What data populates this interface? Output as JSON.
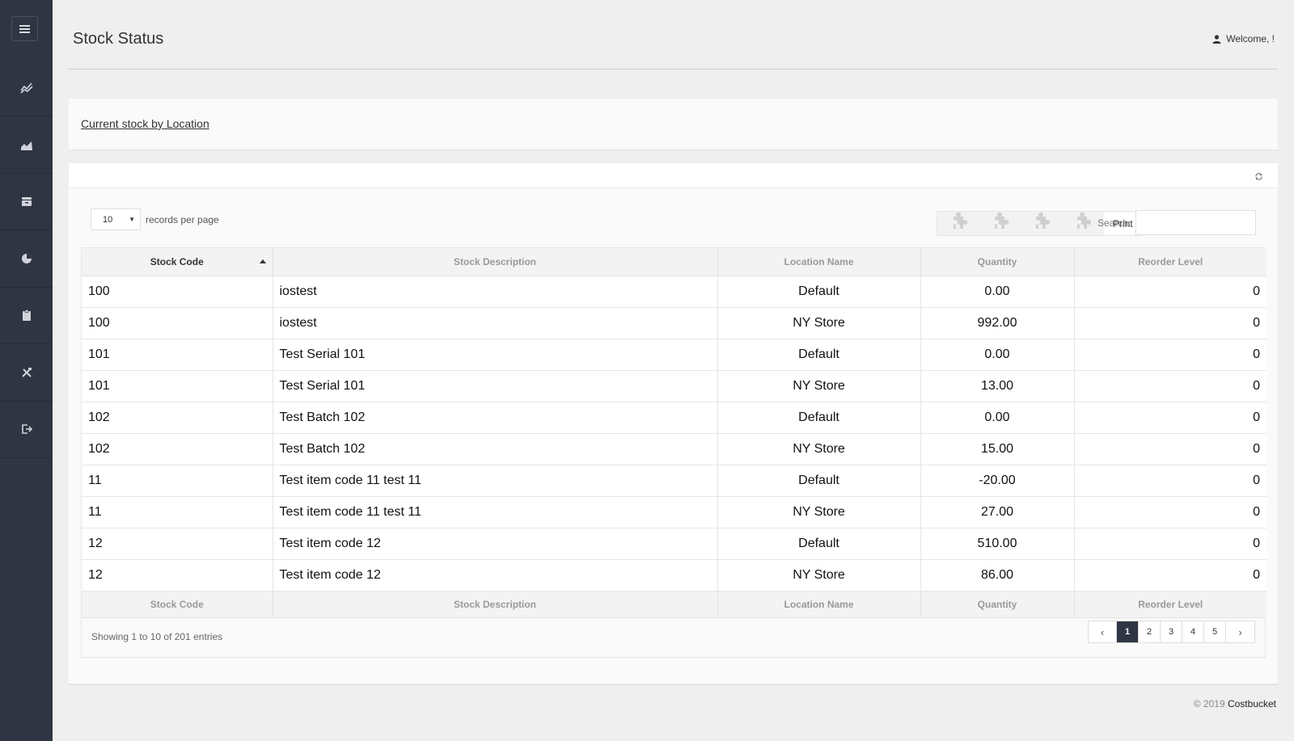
{
  "app": {
    "page_title": "Stock Status",
    "welcome": "Welcome, !",
    "footer_copy": "© 2019",
    "footer_brand": "Costbucket"
  },
  "sidebar": {
    "items": [
      {
        "name": "sidebar-item-trends",
        "icon": "trend-lines-icon"
      },
      {
        "name": "sidebar-item-area-chart",
        "icon": "area-chart-icon"
      },
      {
        "name": "sidebar-item-inventory",
        "icon": "inbox-icon"
      },
      {
        "name": "sidebar-item-reports",
        "icon": "pie-chart-icon"
      },
      {
        "name": "sidebar-item-clipboard",
        "icon": "clipboard-icon"
      },
      {
        "name": "sidebar-item-tools",
        "icon": "tools-icon"
      },
      {
        "name": "sidebar-item-logout",
        "icon": "logout-icon"
      }
    ]
  },
  "panel": {
    "link_label": "Current stock by Location"
  },
  "controls": {
    "records_per_page_value": "10",
    "records_per_page_label": "records per page",
    "print_label": "Print",
    "search_label": "Search:",
    "search_value": ""
  },
  "table": {
    "columns": [
      "Stock Code",
      "Stock Description",
      "Location Name",
      "Quantity",
      "Reorder Level"
    ],
    "rows": [
      [
        "100",
        "iostest",
        "Default",
        "0.00",
        "0"
      ],
      [
        "100",
        "iostest",
        "NY Store",
        "992.00",
        "0"
      ],
      [
        "101",
        "Test Serial 101",
        "Default",
        "0.00",
        "0"
      ],
      [
        "101",
        "Test Serial 101",
        "NY Store",
        "13.00",
        "0"
      ],
      [
        "102",
        "Test Batch 102",
        "Default",
        "0.00",
        "0"
      ],
      [
        "102",
        "Test Batch 102",
        "NY Store",
        "15.00",
        "0"
      ],
      [
        "11",
        "Test item code 11 test 11",
        "Default",
        "-20.00",
        "0"
      ],
      [
        "11",
        "Test item code 11 test 11",
        "NY Store",
        "27.00",
        "0"
      ],
      [
        "12",
        "Test item code 12",
        "Default",
        "510.00",
        "0"
      ],
      [
        "12",
        "Test item code 12",
        "NY Store",
        "86.00",
        "0"
      ]
    ],
    "info": "Showing 1 to 10 of 201 entries"
  },
  "pagination": {
    "prev": "‹",
    "next": "›",
    "pages": [
      "1",
      "2",
      "3",
      "4",
      "5"
    ],
    "active": "1"
  },
  "colors": {
    "sidebar": "#2f3542",
    "active_page": "#2f3542"
  }
}
